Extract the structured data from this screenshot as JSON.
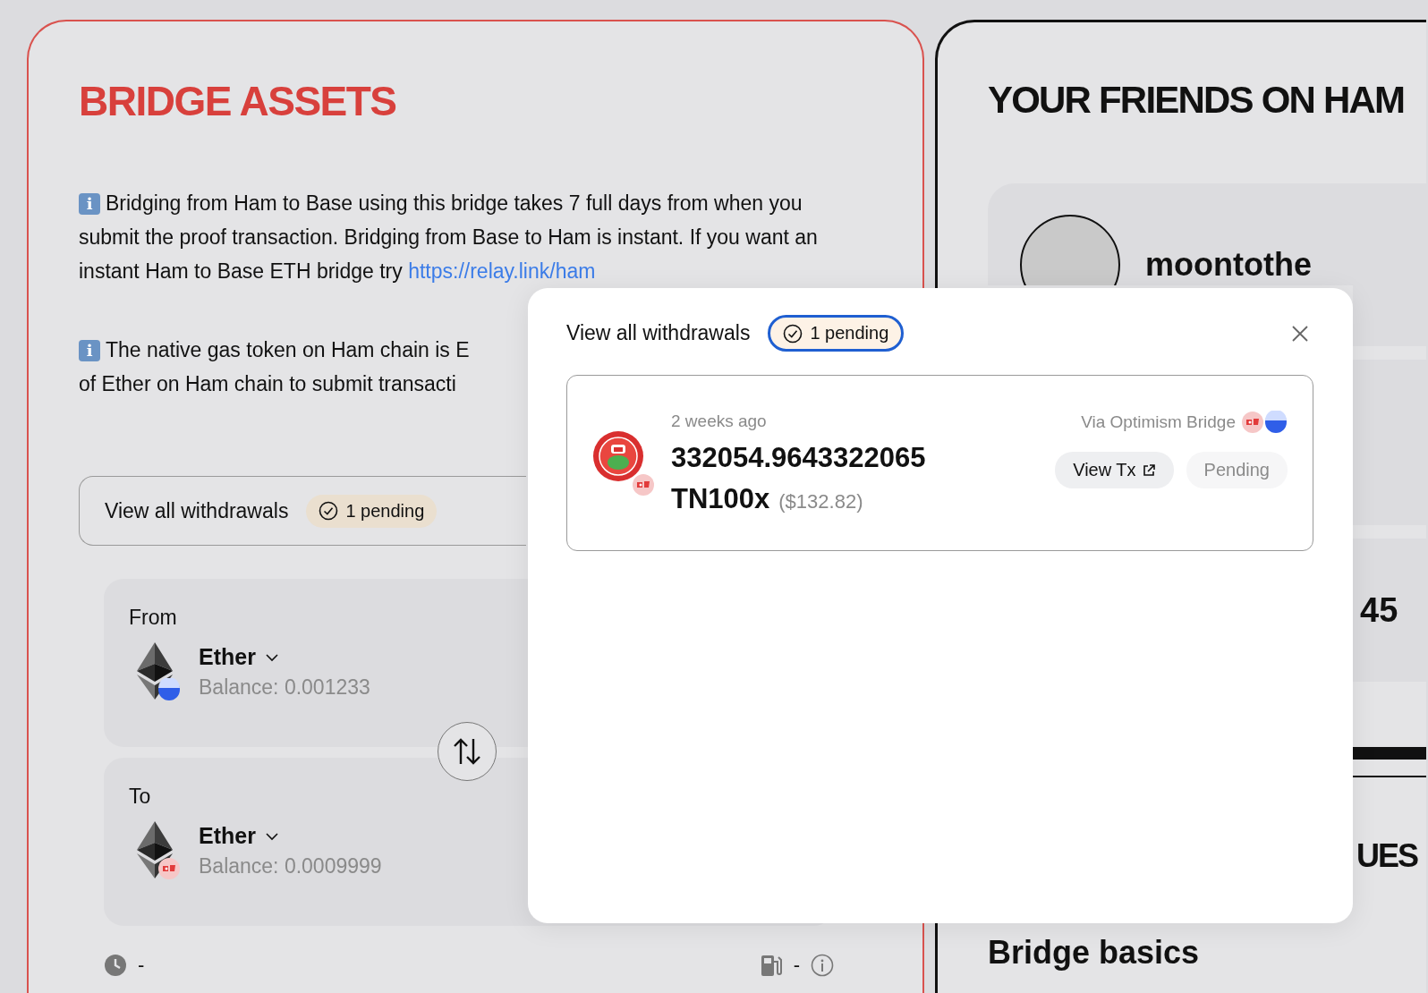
{
  "bridge": {
    "title": "BRIDGE ASSETS",
    "notice": {
      "icon": "ℹ",
      "text": "Bridging from Ham to Base using this bridge takes 7 full days from when you submit the proof transaction. Bridging from Base to Ham is instant. If you want an instant Ham to Base ETH bridge try ",
      "link": "https://relay.link/ham"
    },
    "notice_2_icon": "ℹ",
    "notice_2_lines": [
      "The native gas token on Ham chain is E",
      "of Ether on Ham chain to submit transacti"
    ],
    "withdrawals_bar": {
      "label": "View all withdrawals",
      "pending": "1 pending"
    },
    "legs": [
      {
        "label": "From",
        "token": "Ether",
        "balance": "Balance: 0.001233",
        "kind": "base"
      },
      {
        "label": "To",
        "token": "Ether",
        "balance": "Balance: 0.0009999",
        "kind": "ham"
      }
    ],
    "footer": {
      "time": "-",
      "gas": "-"
    }
  },
  "friends": {
    "title": "YOUR FRIENDS ON HAM",
    "friends": [
      {
        "name": "moontothe"
      }
    ],
    "stat_partial": "45",
    "section_partial": "UES",
    "next_heading": "Bridge basics"
  },
  "modal": {
    "title": "View all withdrawals",
    "pending": "1 pending",
    "withdrawals": [
      {
        "time": "2 weeks ago",
        "amount": "332054.9643322065",
        "token": "TN100x",
        "usd": "($132.82)",
        "via": "Via Optimism Bridge",
        "actions": [
          {
            "kind": "link",
            "label": "View Tx"
          },
          {
            "kind": "status",
            "label": "Pending"
          }
        ]
      }
    ]
  }
}
